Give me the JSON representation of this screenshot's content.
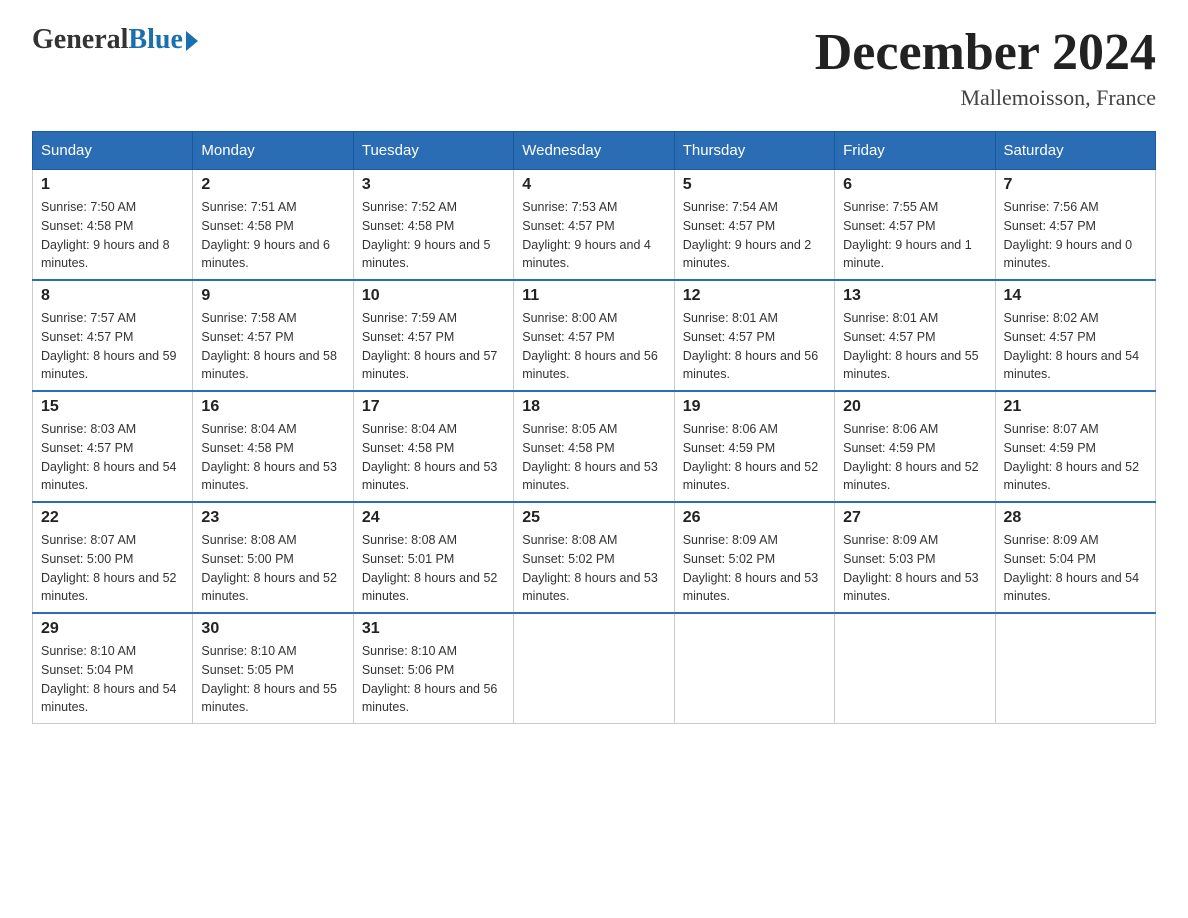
{
  "header": {
    "logo_general": "General",
    "logo_blue": "Blue",
    "month_title": "December 2024",
    "location": "Mallemoisson, France"
  },
  "days_of_week": [
    "Sunday",
    "Monday",
    "Tuesday",
    "Wednesday",
    "Thursday",
    "Friday",
    "Saturday"
  ],
  "weeks": [
    [
      {
        "day": "1",
        "sunrise": "7:50 AM",
        "sunset": "4:58 PM",
        "daylight": "9 hours and 8 minutes."
      },
      {
        "day": "2",
        "sunrise": "7:51 AM",
        "sunset": "4:58 PM",
        "daylight": "9 hours and 6 minutes."
      },
      {
        "day": "3",
        "sunrise": "7:52 AM",
        "sunset": "4:58 PM",
        "daylight": "9 hours and 5 minutes."
      },
      {
        "day": "4",
        "sunrise": "7:53 AM",
        "sunset": "4:57 PM",
        "daylight": "9 hours and 4 minutes."
      },
      {
        "day": "5",
        "sunrise": "7:54 AM",
        "sunset": "4:57 PM",
        "daylight": "9 hours and 2 minutes."
      },
      {
        "day": "6",
        "sunrise": "7:55 AM",
        "sunset": "4:57 PM",
        "daylight": "9 hours and 1 minute."
      },
      {
        "day": "7",
        "sunrise": "7:56 AM",
        "sunset": "4:57 PM",
        "daylight": "9 hours and 0 minutes."
      }
    ],
    [
      {
        "day": "8",
        "sunrise": "7:57 AM",
        "sunset": "4:57 PM",
        "daylight": "8 hours and 59 minutes."
      },
      {
        "day": "9",
        "sunrise": "7:58 AM",
        "sunset": "4:57 PM",
        "daylight": "8 hours and 58 minutes."
      },
      {
        "day": "10",
        "sunrise": "7:59 AM",
        "sunset": "4:57 PM",
        "daylight": "8 hours and 57 minutes."
      },
      {
        "day": "11",
        "sunrise": "8:00 AM",
        "sunset": "4:57 PM",
        "daylight": "8 hours and 56 minutes."
      },
      {
        "day": "12",
        "sunrise": "8:01 AM",
        "sunset": "4:57 PM",
        "daylight": "8 hours and 56 minutes."
      },
      {
        "day": "13",
        "sunrise": "8:01 AM",
        "sunset": "4:57 PM",
        "daylight": "8 hours and 55 minutes."
      },
      {
        "day": "14",
        "sunrise": "8:02 AM",
        "sunset": "4:57 PM",
        "daylight": "8 hours and 54 minutes."
      }
    ],
    [
      {
        "day": "15",
        "sunrise": "8:03 AM",
        "sunset": "4:57 PM",
        "daylight": "8 hours and 54 minutes."
      },
      {
        "day": "16",
        "sunrise": "8:04 AM",
        "sunset": "4:58 PM",
        "daylight": "8 hours and 53 minutes."
      },
      {
        "day": "17",
        "sunrise": "8:04 AM",
        "sunset": "4:58 PM",
        "daylight": "8 hours and 53 minutes."
      },
      {
        "day": "18",
        "sunrise": "8:05 AM",
        "sunset": "4:58 PM",
        "daylight": "8 hours and 53 minutes."
      },
      {
        "day": "19",
        "sunrise": "8:06 AM",
        "sunset": "4:59 PM",
        "daylight": "8 hours and 52 minutes."
      },
      {
        "day": "20",
        "sunrise": "8:06 AM",
        "sunset": "4:59 PM",
        "daylight": "8 hours and 52 minutes."
      },
      {
        "day": "21",
        "sunrise": "8:07 AM",
        "sunset": "4:59 PM",
        "daylight": "8 hours and 52 minutes."
      }
    ],
    [
      {
        "day": "22",
        "sunrise": "8:07 AM",
        "sunset": "5:00 PM",
        "daylight": "8 hours and 52 minutes."
      },
      {
        "day": "23",
        "sunrise": "8:08 AM",
        "sunset": "5:00 PM",
        "daylight": "8 hours and 52 minutes."
      },
      {
        "day": "24",
        "sunrise": "8:08 AM",
        "sunset": "5:01 PM",
        "daylight": "8 hours and 52 minutes."
      },
      {
        "day": "25",
        "sunrise": "8:08 AM",
        "sunset": "5:02 PM",
        "daylight": "8 hours and 53 minutes."
      },
      {
        "day": "26",
        "sunrise": "8:09 AM",
        "sunset": "5:02 PM",
        "daylight": "8 hours and 53 minutes."
      },
      {
        "day": "27",
        "sunrise": "8:09 AM",
        "sunset": "5:03 PM",
        "daylight": "8 hours and 53 minutes."
      },
      {
        "day": "28",
        "sunrise": "8:09 AM",
        "sunset": "5:04 PM",
        "daylight": "8 hours and 54 minutes."
      }
    ],
    [
      {
        "day": "29",
        "sunrise": "8:10 AM",
        "sunset": "5:04 PM",
        "daylight": "8 hours and 54 minutes."
      },
      {
        "day": "30",
        "sunrise": "8:10 AM",
        "sunset": "5:05 PM",
        "daylight": "8 hours and 55 minutes."
      },
      {
        "day": "31",
        "sunrise": "8:10 AM",
        "sunset": "5:06 PM",
        "daylight": "8 hours and 56 minutes."
      },
      null,
      null,
      null,
      null
    ]
  ]
}
